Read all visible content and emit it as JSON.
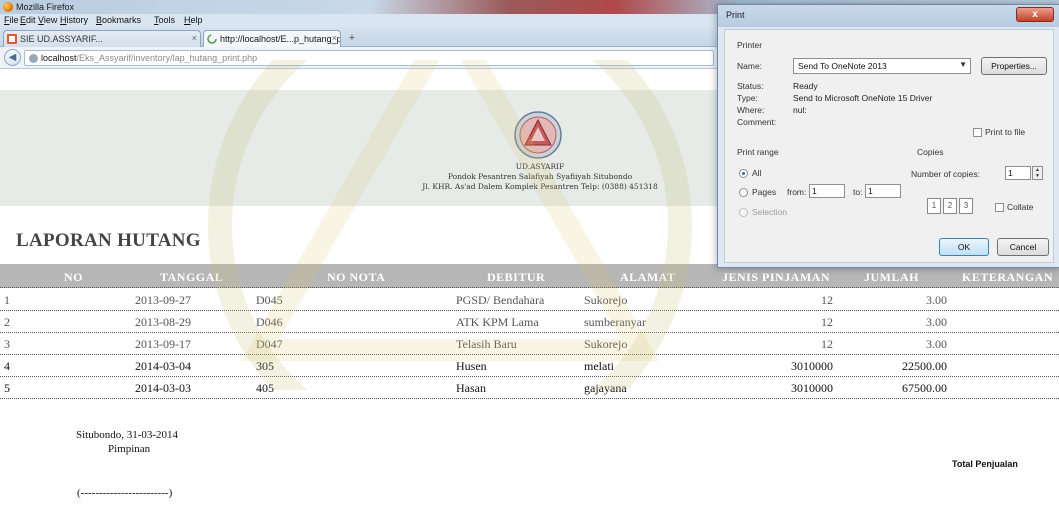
{
  "browser": {
    "window_title": "Mozilla Firefox",
    "menu": [
      "File",
      "Edit",
      "View",
      "History",
      "Bookmarks",
      "Tools",
      "Help"
    ],
    "tabs": [
      {
        "label": "SIE UD.ASSYARIF...",
        "active": false
      },
      {
        "label": "http://localhost/E...p_hutang_print.php",
        "active": true
      }
    ],
    "url_host": "localhost",
    "url_path": "/Eks_Assyarif/inventory/lap_hutang_print.php",
    "accent_colors": {
      "titlebar_red": "#b04848",
      "chrome_blue": "#d9e5f1"
    }
  },
  "report": {
    "org_name": "UD.ASYARIF",
    "org_line2": "Pondok Pesantren Salafiyah Syafiiyah Situbondo",
    "org_line3": "Jl. KHR. As'ad Dalem Komplek Pesantren Telp: (0388) 451318",
    "title": "LAPORAN HUTANG",
    "columns": [
      "NO",
      "TANGGAL",
      "NO NOTA",
      "DEBITUR",
      "ALAMAT",
      "JENIS PINJAMAN",
      "JUMLAH",
      "KETERANGAN"
    ],
    "rows": [
      {
        "no": "1",
        "tanggal": "2013-09-27",
        "nota": "D045",
        "debitur": "PGSD/ Bendahara",
        "alamat": "Sukorejo",
        "jenis": "12",
        "jumlah": "3.00",
        "keterangan": ""
      },
      {
        "no": "2",
        "tanggal": "2013-08-29",
        "nota": "D046",
        "debitur": "ATK KPM Lama",
        "alamat": "sumberanyar",
        "jenis": "12",
        "jumlah": "3.00",
        "keterangan": ""
      },
      {
        "no": "3",
        "tanggal": "2013-09-17",
        "nota": "D047",
        "debitur": "Telasih Baru",
        "alamat": "Sukorejo",
        "jenis": "12",
        "jumlah": "3.00",
        "keterangan": ""
      },
      {
        "no": "4",
        "tanggal": "2014-03-04",
        "nota": "305",
        "debitur": "Husen",
        "alamat": "melati",
        "jenis": "3010000",
        "jumlah": "22500.00",
        "keterangan": ""
      },
      {
        "no": "5",
        "tanggal": "2014-03-03",
        "nota": "405",
        "debitur": "Hasan",
        "alamat": "gajayana",
        "jenis": "3010000",
        "jumlah": "67500.00",
        "keterangan": ""
      }
    ],
    "footer_place_date": "Situbondo, 31-03-2014",
    "footer_role": "Pimpinan",
    "footer_signature": "(------------------------)",
    "total_label": "Total Penjualan",
    "table_header_color": "#b6b6b6"
  },
  "print_dialog": {
    "title": "Print",
    "close_label": "x",
    "printer_group": "Printer",
    "name_label": "Name:",
    "name_value": "Send To OneNote 2013",
    "properties_label": "Properties...",
    "status_label": "Status:",
    "status_value": "Ready",
    "type_label": "Type:",
    "type_value": "Send to Microsoft OneNote 15 Driver",
    "where_label": "Where:",
    "where_value": "nul:",
    "comment_label": "Comment:",
    "print_to_file_label": "Print to file",
    "print_range_group": "Print range",
    "all_label": "All",
    "pages_label": "Pages",
    "from_label": "from:",
    "from_value": "1",
    "to_label": "to:",
    "to_value": "1",
    "selection_label": "Selection",
    "copies_group": "Copies",
    "num_copies_label": "Number of copies:",
    "num_copies_value": "1",
    "collate_label": "Collate",
    "ok_label": "OK",
    "cancel_label": "Cancel"
  }
}
